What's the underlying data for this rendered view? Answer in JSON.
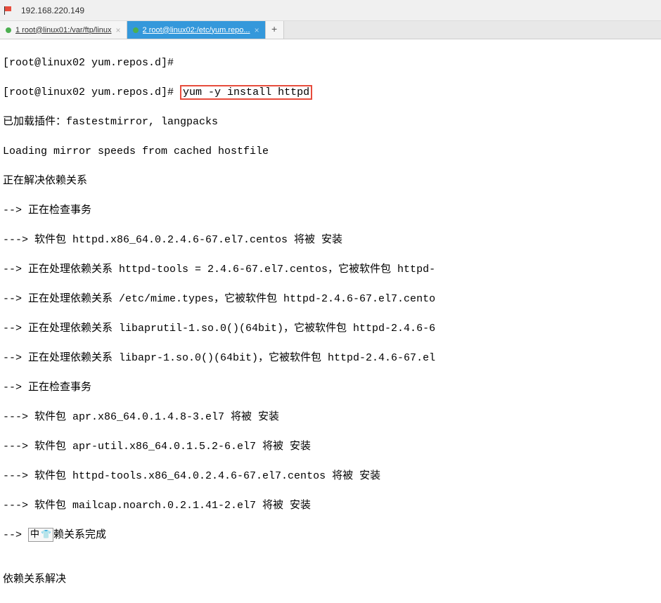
{
  "titlebar": {
    "address": "192.168.220.149"
  },
  "tabs": {
    "tab1_label": "1 root@linux01:/var/ftp/linux",
    "tab2_label": "2 root@linux02:/etc/yum.repo...",
    "add_label": "+"
  },
  "terminal": {
    "line1_prompt": "[root@linux02 yum.repos.d]# ",
    "line2_prompt": "[root@linux02 yum.repos.d]# ",
    "line2_cmd": "yum -y install httpd",
    "line3": "已加载插件：fastestmirror, langpacks",
    "line4": "Loading mirror speeds from cached hostfile",
    "line5": "正在解决依赖关系",
    "line6": "--> 正在检查事务",
    "line7": "---> 软件包 httpd.x86_64.0.2.4.6-67.el7.centos 将被 安装",
    "line8": "--> 正在处理依赖关系 httpd-tools = 2.4.6-67.el7.centos，它被软件包 httpd-",
    "line9": "--> 正在处理依赖关系 /etc/mime.types，它被软件包 httpd-2.4.6-67.el7.cento",
    "line10": "--> 正在处理依赖关系 libaprutil-1.so.0()(64bit)，它被软件包 httpd-2.4.6-6",
    "line11": "--> 正在处理依赖关系 libapr-1.so.0()(64bit)，它被软件包 httpd-2.4.6-67.el",
    "line12": "--> 正在检查事务",
    "line13": "---> 软件包 apr.x86_64.0.1.4.8-3.el7 将被 安装",
    "line14": "---> 软件包 apr-util.x86_64.0.1.5.2-6.el7 将被 安装",
    "line15": "---> 软件包 httpd-tools.x86_64.0.2.4.6-67.el7.centos 将被 安装",
    "line16_a": "---> 软件包 mailcap.noarch.0.2.1.41-2.el7 将被 安装",
    "line17_prefix": "--> ",
    "line17_ime_char": "中",
    "line17_suffix": "赖关系完成",
    "line18": "",
    "line19": "依赖关系解决"
  }
}
